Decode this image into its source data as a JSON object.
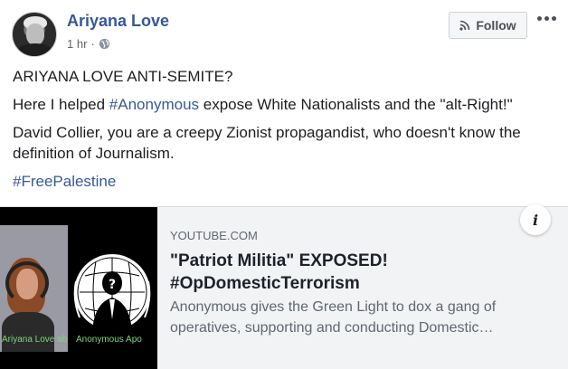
{
  "header": {
    "author_name": "Ariyana Love",
    "timestamp": "1 hr",
    "separator": "·",
    "follow_label": "Follow",
    "avatar_icon": "profile-photo",
    "audience_icon": "globe-icon"
  },
  "post": {
    "line1": "ARIYANA LOVE ANTI-SEMITE?",
    "line2_before": "Here I helped ",
    "line2_hashtag": "#Anonymous",
    "line2_after": " expose White Nationalists and the \"alt-Right!\"",
    "line3": "David Collier, you are a creepy Zionist propagandist, who doesn't know the definition of Journalism.",
    "hashtag_line": "#FreePalestine"
  },
  "link_card": {
    "domain": "YOUTUBE.COM",
    "title": "\"Patriot Militia\" EXPOSED! #OpDomesticTerrorism",
    "description": "Anonymous gives the Green Light to dox a gang of operatives, supporting and conducting Domestic…",
    "thumbnail_caption_left": "Ariyana Love ab",
    "thumbnail_caption_right": "Anonymous Apo",
    "info_icon": "i"
  },
  "colors": {
    "link_blue": "#385898",
    "card_bg": "#f2f3f5",
    "meta_gray": "#616770"
  }
}
